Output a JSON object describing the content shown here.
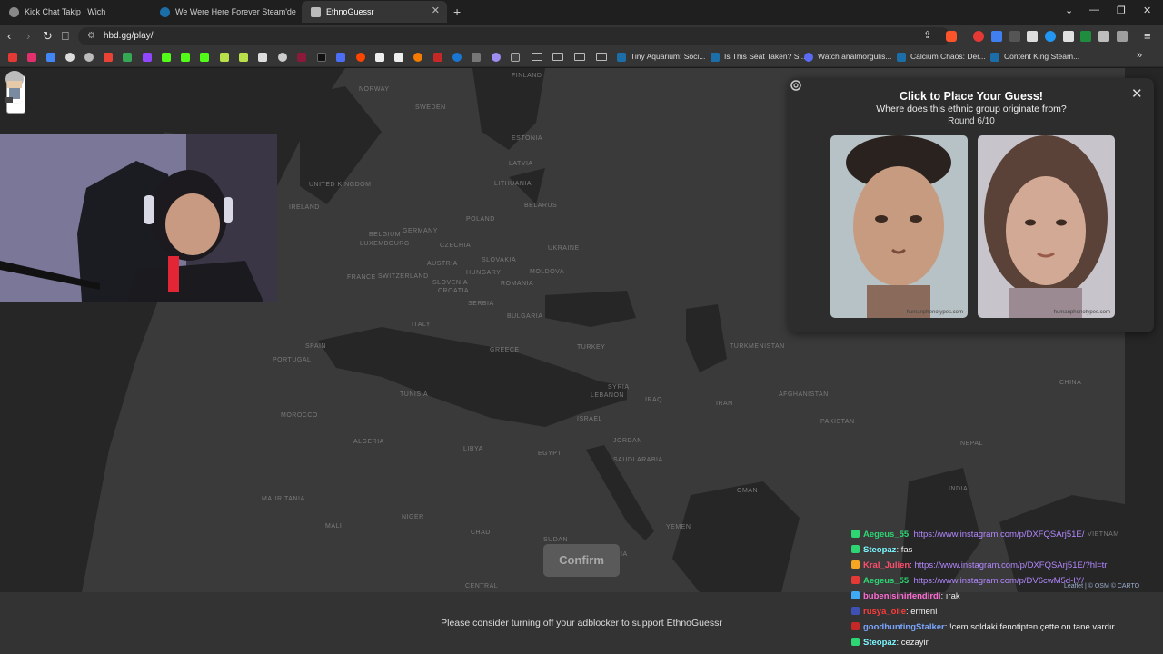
{
  "browser": {
    "tabs": [
      {
        "title": "Kick Chat Takip | Wich",
        "active": false
      },
      {
        "title": "We Were Here Forever Steam'de",
        "active": false
      },
      {
        "title": "EthnoGuessr",
        "active": true
      }
    ],
    "url": "hbd.gg/play/",
    "bookmarks": [
      "Tiny Aquarium: Soci...",
      "Is This Seat Taken? S...",
      "Watch analmorgulis...",
      "Calcium Chaos: Der...",
      "Content King Steam..."
    ]
  },
  "map": {
    "zoom_in_label": "+",
    "zoom_out_label": "−",
    "countries": [
      "FINLAND",
      "NORWAY",
      "SWEDEN",
      "ESTONIA",
      "LATVIA",
      "LITHUANIA",
      "BELARUS",
      "POLAND",
      "GERMANY",
      "UNITED KINGDOM",
      "IRELAND",
      "BELGIUM",
      "LUXEMBOURG",
      "CZECHIA",
      "UKRAINE",
      "SLOVAKIA",
      "AUSTRIA",
      "HUNGARY",
      "MOLDOVA",
      "FRANCE",
      "SWITZERLAND",
      "SLOVENIA",
      "CROATIA",
      "ROMANIA",
      "SERBIA",
      "BULGARIA",
      "SPAIN",
      "PORTUGAL",
      "ITALY",
      "GREECE",
      "TURKEY",
      "TURKMENISTAN",
      "TUNISIA",
      "SYRIA",
      "LEBANON",
      "ISRAEL",
      "IRAQ",
      "IRAN",
      "AFGHANISTAN",
      "MOROCCO",
      "ALGERIA",
      "LIBYA",
      "EGYPT",
      "JORDAN",
      "SAUDI ARABIA",
      "PAKISTAN",
      "NEPAL",
      "CHINA",
      "MAURITANIA",
      "MALI",
      "NIGER",
      "CHAD",
      "SUDAN",
      "ETHIOPIA",
      "YEMEN",
      "OMAN",
      "INDIA",
      "VIETNAM",
      "CENTRAL"
    ],
    "attribution": "Leaflet | © OSM © CARTO"
  },
  "panel": {
    "title": "Click to Place Your Guess!",
    "subtitle": "Where does this ethnic group originate from?",
    "round": "Round 6/10",
    "faces": [
      {
        "label": "male composite face",
        "credit": "humanphenotypes.com"
      },
      {
        "label": "female composite face",
        "credit": "humanphenotypes.com"
      }
    ]
  },
  "confirm_label": "Confirm",
  "adblock_message": "Please consider turning off your adblocker to support EthnoGuessr",
  "chat": [
    {
      "user": "Aegeus_55",
      "message": ": https://www.instagram.com/p/DXFQSArj51E/",
      "user_color": "#2ed573",
      "link": true
    },
    {
      "user": "Steopaz",
      "message": ": fas",
      "user_color": "#7cf6ff",
      "link": false
    },
    {
      "user": "Kral_Julien",
      "message": ": https://www.instagram.com/p/DXFQSArj51E/?hl=tr",
      "user_color": "#ff4d6d",
      "link": true
    },
    {
      "user": "Aegeus_55",
      "message": ": https://www.instagram.com/p/DV6cwM5d-IY/",
      "user_color": "#2ed573",
      "link": true
    },
    {
      "user": "bubenisinirlendirdi",
      "message": ": ırak",
      "user_color": "#ff6bd5",
      "link": false
    },
    {
      "user": "rusya_oile",
      "message": ": ermeni",
      "user_color": "#ff3b3b",
      "link": false
    },
    {
      "user": "goodhuntingStalker",
      "message": ": !cem soldaki fenotipten çette on tane vardır",
      "user_color": "#7aa6ff",
      "link": false
    },
    {
      "user": "Steopaz",
      "message": ": cezayir",
      "user_color": "#7cf6ff",
      "link": false
    }
  ],
  "colors": {
    "accent": "#b388ff",
    "panel_bg": "#2d2d2d",
    "map_bg": "#262626"
  }
}
